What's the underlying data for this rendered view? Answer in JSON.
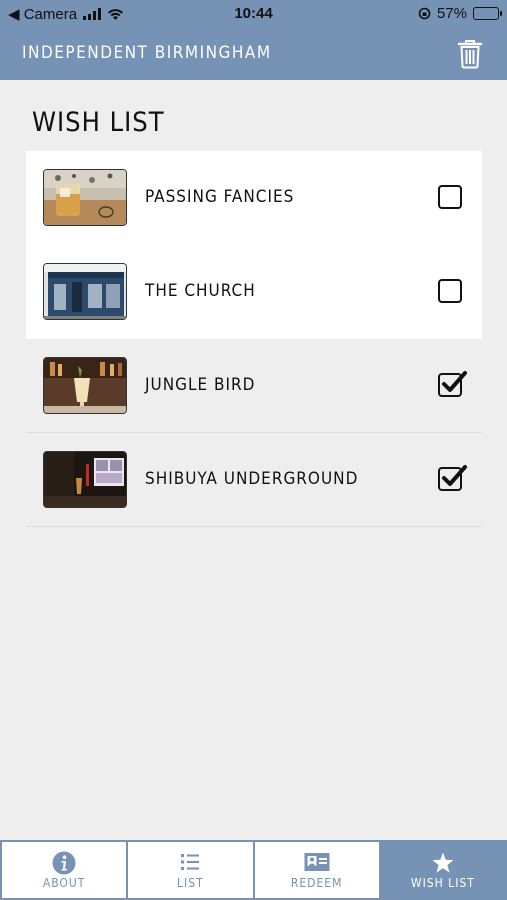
{
  "status": {
    "carrier": "◀ Camera",
    "time": "10:44",
    "battery": "57%",
    "battery_level": 0.57
  },
  "header": {
    "title": "INDEPENDENT BIRMINGHAM",
    "delete_icon": "trash-icon"
  },
  "page_title": "WISH LIST",
  "items": [
    {
      "label": "PASSING FANCIES",
      "checked": false
    },
    {
      "label": "THE CHURCH",
      "checked": false
    },
    {
      "label": "JUNGLE BIRD",
      "checked": true
    },
    {
      "label": "SHIBUYA UNDERGROUND",
      "checked": true
    }
  ],
  "tabs": [
    {
      "label": "ABOUT",
      "icon": "info-icon",
      "active": false
    },
    {
      "label": "LIST",
      "icon": "list-icon",
      "active": false
    },
    {
      "label": "REDEEM",
      "icon": "card-icon",
      "active": false
    },
    {
      "label": "WISH LIST",
      "icon": "star-icon",
      "active": true
    }
  ],
  "colors": {
    "primary": "#7692b4",
    "background": "#eeeeee",
    "battery": "#f5d142"
  }
}
